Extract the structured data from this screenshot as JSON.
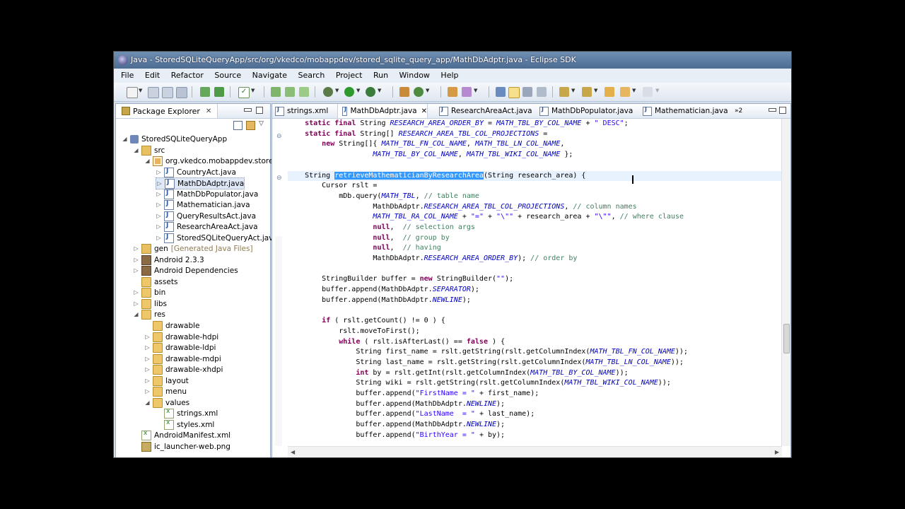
{
  "window": {
    "title": "Java - StoredSQLiteQueryApp/src/org/vkedco/mobappdev/stored_sqlite_query_app/MathDbAdptr.java - Eclipse SDK"
  },
  "menu": [
    "File",
    "Edit",
    "Refactor",
    "Source",
    "Navigate",
    "Search",
    "Project",
    "Run",
    "Window",
    "Help"
  ],
  "package_explorer": {
    "title": "Package Explorer",
    "tree": [
      {
        "label": "StoredSQLiteQueryApp",
        "icon": "project-icon"
      },
      {
        "label": "src",
        "icon": "source-folder-icon"
      },
      {
        "label": "org.vkedco.mobappdev.stored",
        "icon": "package-icon"
      },
      {
        "label": "CountryAct.java",
        "icon": "java-file-icon"
      },
      {
        "label": "MathDbAdptr.java",
        "icon": "java-file-icon",
        "selected": true
      },
      {
        "label": "MathDbPopulator.java",
        "icon": "java-file-icon"
      },
      {
        "label": "Mathematician.java",
        "icon": "java-file-icon"
      },
      {
        "label": "QueryResultsAct.java",
        "icon": "java-file-icon"
      },
      {
        "label": "ResearchAreaAct.java",
        "icon": "java-file-icon"
      },
      {
        "label": "StoredSQLiteQueryAct.java",
        "icon": "java-file-icon"
      },
      {
        "label": "gen",
        "label_suffix": "[Generated Java Files]",
        "icon": "source-folder-icon"
      },
      {
        "label": "Android 2.3.3",
        "icon": "library-icon"
      },
      {
        "label": "Android Dependencies",
        "icon": "library-icon"
      },
      {
        "label": "assets",
        "icon": "folder-icon"
      },
      {
        "label": "bin",
        "icon": "folder-icon"
      },
      {
        "label": "libs",
        "icon": "folder-icon"
      },
      {
        "label": "res",
        "icon": "folder-icon"
      },
      {
        "label": "drawable",
        "icon": "folder-icon"
      },
      {
        "label": "drawable-hdpi",
        "icon": "folder-icon"
      },
      {
        "label": "drawable-ldpi",
        "icon": "folder-icon"
      },
      {
        "label": "drawable-mdpi",
        "icon": "folder-icon"
      },
      {
        "label": "drawable-xhdpi",
        "icon": "folder-icon"
      },
      {
        "label": "layout",
        "icon": "folder-icon"
      },
      {
        "label": "menu",
        "icon": "folder-icon"
      },
      {
        "label": "values",
        "icon": "folder-icon"
      },
      {
        "label": "strings.xml",
        "icon": "xml-file-icon"
      },
      {
        "label": "styles.xml",
        "icon": "xml-file-icon"
      },
      {
        "label": "AndroidManifest.xml",
        "icon": "xml-file-icon"
      },
      {
        "label": "ic_launcher-web.png",
        "icon": "image-file-icon"
      }
    ]
  },
  "editor": {
    "tabs": [
      {
        "label": "strings.xml"
      },
      {
        "label": "MathDbAdptr.java",
        "active": true
      },
      {
        "label": "ResearchAreaAct.java"
      },
      {
        "label": "MathDbPopulator.java"
      },
      {
        "label": "Mathematician.java"
      }
    ],
    "overflow_tabs": "»2",
    "code": {
      "l1": {
        "a": "    ",
        "kw1": "static final",
        "b": " String ",
        "c1": "RESEARCH_AREA_ORDER_BY",
        "d": " = ",
        "c2": "MATH_TBL_BY_COL_NAME",
        "e": " + ",
        "s": "\" DESC\"",
        "f": ";"
      },
      "l2": {
        "a": "    ",
        "kw1": "static final",
        "b": " String[] ",
        "c1": "RESEARCH_AREA_TBL_COL_PROJECTIONS",
        "d": " ="
      },
      "l3": {
        "a": "        ",
        "kw1": "new",
        "b": " String[]{ ",
        "c1": "MATH_TBL_FN_COL_NAME",
        "d": ", ",
        "c2": "MATH_TBL_LN_COL_NAME",
        "e": ","
      },
      "l4": {
        "a": "                    ",
        "c1": "MATH_TBL_BY_COL_NAME",
        "d": ", ",
        "c2": "MATH_TBL_WIKI_COL_NAME",
        "e": " };"
      },
      "l5": {
        "a": "    String ",
        "h": "retrieveMathematicianByResearchArea",
        "b": "(String research_area) {"
      },
      "l6": "        Cursor rslt =",
      "l7": {
        "a": "            mDb.query(",
        "c1": "MATH_TBL",
        "b": ", ",
        "cm": "// table name"
      },
      "l8": {
        "a": "                    MathDbAdptr.",
        "c1": "RESEARCH_AREA_TBL_COL_PROJECTIONS",
        "b": ", ",
        "cm": "// column names"
      },
      "l9": {
        "a": "                    ",
        "c1": "MATH_TBL_RA_COL_NAME",
        "b": " + ",
        "s1": "\"=\"",
        "c": " + ",
        "s2": "\"\\\"\"",
        "d": " + research_area + ",
        "s3": "\"\\\"\"",
        "e": ", ",
        "cm": "// where clause"
      },
      "l10": {
        "a": "                    ",
        "kw": "null",
        "b": ",  ",
        "cm": "// selection args"
      },
      "l11": {
        "a": "                    ",
        "kw": "null",
        "b": ",  ",
        "cm": "// group by"
      },
      "l12": {
        "a": "                    ",
        "kw": "null",
        "b": ",  ",
        "cm": "// having"
      },
      "l13": {
        "a": "                    MathDbAdptr.",
        "c1": "RESEARCH_AREA_ORDER_BY",
        "b": "); ",
        "cm": "// order by"
      },
      "l14": {
        "a": "        StringBuilder buffer = ",
        "kw": "new",
        "b": " StringBuilder(",
        "s": "\"\"",
        "c": ");"
      },
      "l15": {
        "a": "        buffer.append(MathDbAdptr.",
        "c1": "SEPARATOR",
        "b": ");"
      },
      "l16": {
        "a": "        buffer.append(MathDbAdptr.",
        "c1": "NEWLINE",
        "b": ");"
      },
      "l17": {
        "a": "        ",
        "kw": "if",
        "b": " ( rslt.getCount() != 0 ) {"
      },
      "l18": "            rslt.moveToFirst();",
      "l19": {
        "a": "            ",
        "kw1": "while",
        "b": " ( rslt.isAfterLast() == ",
        "kw2": "false",
        "c": " ) {"
      },
      "l20": {
        "a": "                String first_name = rslt.getString(rslt.getColumnIndex(",
        "c1": "MATH_TBL_FN_COL_NAME",
        "b": "));"
      },
      "l21": {
        "a": "                String last_name = rslt.getString(rslt.getColumnIndex(",
        "c1": "MATH_TBL_LN_COL_NAME",
        "b": "));"
      },
      "l22": {
        "a": "                ",
        "kw": "int",
        "b": " by = rslt.getInt(rslt.getColumnIndex(",
        "c1": "MATH_TBL_BY_COL_NAME",
        "c": "));"
      },
      "l23": {
        "a": "                String wiki = rslt.getString(rslt.getColumnIndex(",
        "c1": "MATH_TBL_WIKI_COL_NAME",
        "b": "));"
      },
      "l24": {
        "a": "                buffer.append(",
        "s": "\"FirstName = \"",
        "b": " + first_name);"
      },
      "l25": {
        "a": "                buffer.append(MathDbAdptr.",
        "c1": "NEWLINE",
        "b": ");"
      },
      "l26": {
        "a": "                buffer.append(",
        "s": "\"LastName  = \"",
        "b": " + last_name);"
      },
      "l27": {
        "a": "                buffer.append(MathDbAdptr.",
        "c1": "NEWLINE",
        "b": ");"
      },
      "l28": {
        "a": "                buffer.append(",
        "s": "\"BirthYear = \"",
        "b": " + by);"
      }
    }
  }
}
